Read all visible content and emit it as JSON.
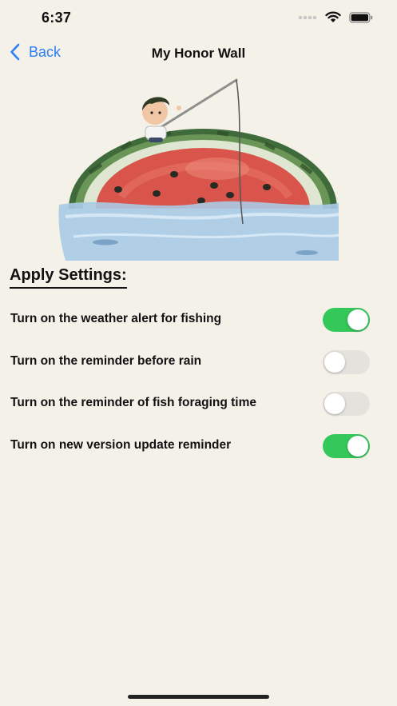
{
  "status_bar": {
    "time": "6:37",
    "signal_icon": "cellular-dots-icon",
    "wifi_icon": "wifi-icon",
    "battery_icon": "battery-icon"
  },
  "nav": {
    "back_label": "Back",
    "back_icon": "chevron-left-icon",
    "title": "My Honor Wall"
  },
  "hero": {
    "description_icon": "boy-fishing-on-watermelon-illustration"
  },
  "settings": {
    "heading": "Apply Settings:",
    "items": [
      {
        "label": "Turn on the weather alert for fishing",
        "enabled": true
      },
      {
        "label": "Turn on the reminder before rain",
        "enabled": false
      },
      {
        "label": "Turn on the reminder of fish foraging time",
        "enabled": false
      },
      {
        "label": "Turn on new version update reminder",
        "enabled": true
      }
    ]
  },
  "colors": {
    "background": "#f4f1e9",
    "accent": "#2f7ef4",
    "toggle_on": "#34c759",
    "toggle_off": "#e4e2dc"
  }
}
